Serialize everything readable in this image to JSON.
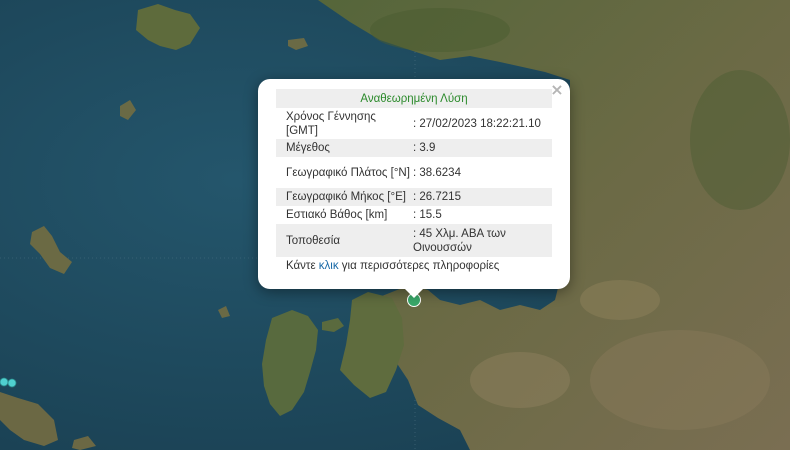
{
  "popup": {
    "title": "Αναθεωρημένη Λύση",
    "close_glyph": "×",
    "rows": [
      {
        "label": "Χρόνος Γέννησης [GMT]",
        "value": ": 27/02/2023 18:22:21.10"
      },
      {
        "label": "Μέγεθος",
        "value": ": 3.9"
      },
      {
        "label": "Γεωγραφικό Πλάτος [°N]",
        "value": ": 38.6234"
      },
      {
        "label": "Γεωγραφικό Μήκος [°E]",
        "value": ": 26.7215"
      },
      {
        "label": "Εστιακό Βάθος [km]",
        "value": ": 15.5"
      },
      {
        "label": "Τοποθεσία",
        "value": ": 45 Χλμ. ΑΒΑ των Οινουσσών"
      }
    ],
    "footer_before": "Κάντε ",
    "footer_link": "κλικ",
    "footer_after": " για περισσότερες πληροφορίες"
  },
  "colors": {
    "sea": "#1e4a5e",
    "land": "#5a6a3a",
    "title_green": "#2b8a2b",
    "marker_green": "#3aa86a",
    "marker_cyan": "#4fd0d0"
  }
}
